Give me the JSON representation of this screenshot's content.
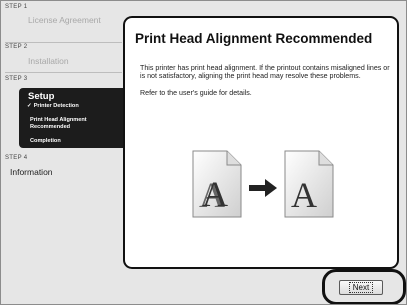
{
  "sidebar": {
    "steps": [
      {
        "label": "STEP 1",
        "title": "License Agreement"
      },
      {
        "label": "STEP 2",
        "title": "Installation"
      },
      {
        "label": "STEP 3",
        "title": "Setup",
        "substeps": [
          {
            "check": "✓",
            "label": "Printer Detection"
          },
          {
            "label": "Print Head Alignment Recommended"
          },
          {
            "label": "Completion"
          }
        ]
      },
      {
        "label": "STEP 4",
        "title": "Information"
      }
    ]
  },
  "panel": {
    "title": "Print Head Alignment Recommended",
    "body": [
      "This printer has print head alignment. If the printout contains misaligned lines or is not satisfactory, aligning the print head may resolve these problems.",
      "Refer to the user's guide for details."
    ],
    "illustration": {
      "left_letter": "A",
      "right_letter": "A",
      "arrow": "→"
    }
  },
  "footer": {
    "next_label": "Next"
  }
}
